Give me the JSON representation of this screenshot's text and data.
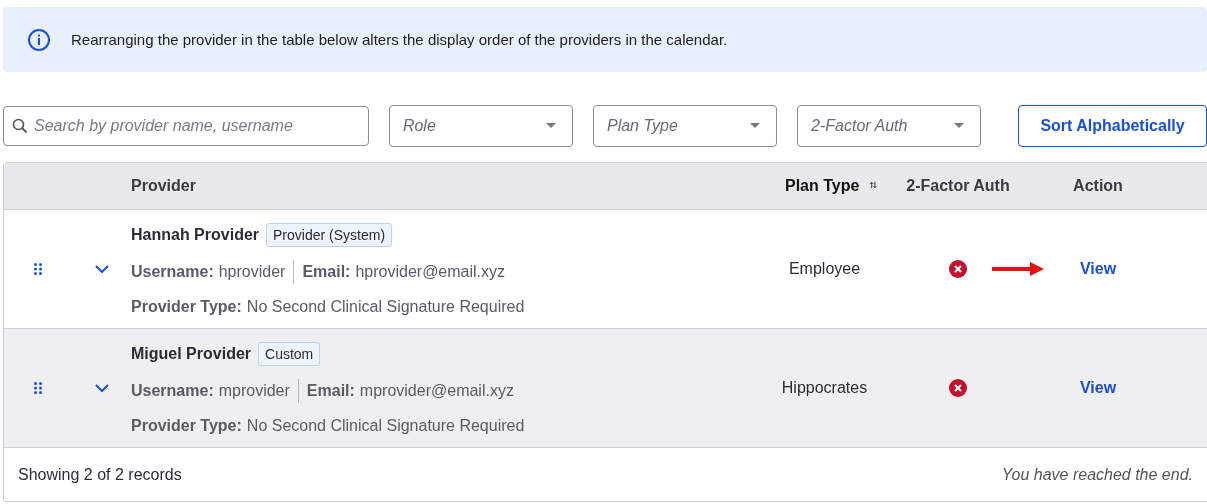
{
  "info_banner": {
    "text": "Rearranging the provider in the table below alters the display order of the providers in the calendar."
  },
  "filters": {
    "search": {
      "placeholder": "Search by provider name, username"
    },
    "dropdowns": [
      {
        "placeholder": "Role"
      },
      {
        "placeholder": "Plan Type"
      },
      {
        "placeholder": "2-Factor Auth"
      }
    ],
    "sort_button": "Sort Alphabetically"
  },
  "table": {
    "columns": [
      "Provider",
      "Plan Type",
      "2-Factor Auth",
      "Action"
    ],
    "rows": [
      {
        "name": "Hannah Provider",
        "role_tag": "Provider (System)",
        "username_label": "Username:",
        "username": "hprovider",
        "email_label": "Email:",
        "email": "hprovider@email.xyz",
        "type_label": "Provider Type:",
        "provider_type": "No Second Clinical Signature Required",
        "plan_type": "Employee",
        "two_factor": false,
        "action": "View",
        "annotated": true,
        "selected": false
      },
      {
        "name": "Miguel Provider",
        "role_tag": "Custom",
        "username_label": "Username:",
        "username": "mprovider",
        "email_label": "Email:",
        "email": "mprovider@email.xyz",
        "type_label": "Provider Type:",
        "provider_type": "No Second Clinical Signature Required",
        "plan_type": "Hippocrates",
        "two_factor": false,
        "action": "View",
        "annotated": false,
        "selected": true
      }
    ],
    "footer": {
      "count": "Showing 2 of 2 records",
      "end_note": "You have reached the end."
    }
  }
}
